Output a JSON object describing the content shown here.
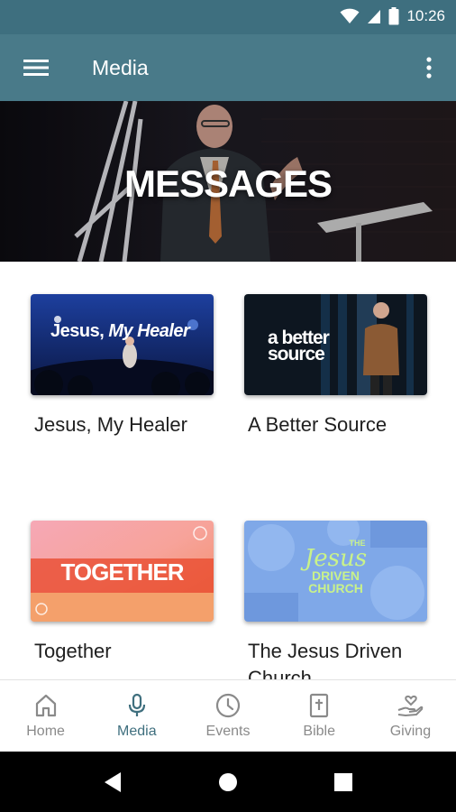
{
  "status": {
    "time": "10:26"
  },
  "app_bar": {
    "title": "Media"
  },
  "hero": {
    "title": "MESSAGES"
  },
  "series": [
    {
      "title": "Jesus, My Healer",
      "thumb_text_1": "Jesus, ",
      "thumb_text_2": "My Healer"
    },
    {
      "title": "A Better Source",
      "thumb_text_1": "a better",
      "thumb_text_2": "source"
    },
    {
      "title": "Together",
      "thumb_text_1": "TOGETHER"
    },
    {
      "title": "The Jesus Driven Church",
      "thumb_text_1": "THE",
      "thumb_text_2": "Jesus",
      "thumb_text_3": "DRIVEN",
      "thumb_text_4": "CHURCH"
    }
  ],
  "nav": {
    "items": [
      {
        "label": "Home",
        "icon": "home-icon"
      },
      {
        "label": "Media",
        "icon": "microphone-icon",
        "active": true
      },
      {
        "label": "Events",
        "icon": "clock-icon"
      },
      {
        "label": "Bible",
        "icon": "bible-icon"
      },
      {
        "label": "Giving",
        "icon": "giving-icon"
      }
    ]
  },
  "colors": {
    "status_bar": "#3e6f7f",
    "app_bar": "#497a89",
    "accent": "#3f6f7e",
    "nav_inactive": "#8a8a8a"
  }
}
